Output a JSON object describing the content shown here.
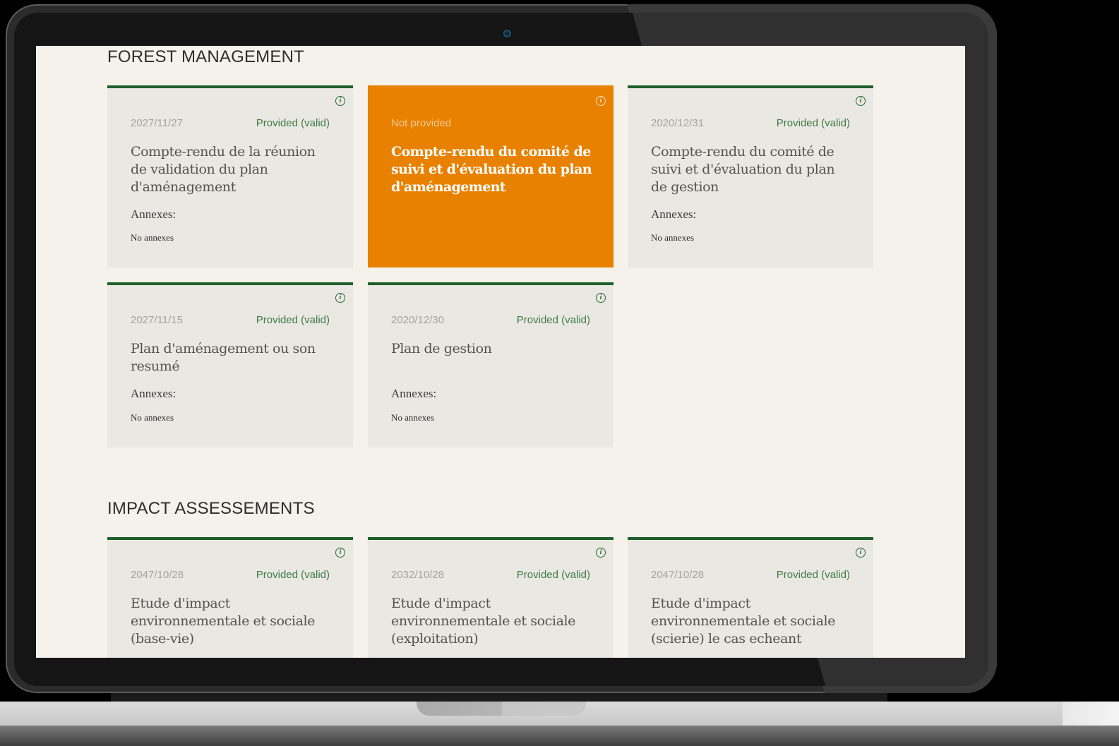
{
  "sections": [
    {
      "title": "FOREST MANAGEMENT",
      "cards": [
        {
          "date": "2027/11/27",
          "status": "Provided (valid)",
          "title": "Compte-rendu de la réunion de validation du plan d'aménagement",
          "annex_label": "Annexes:",
          "annex_value": "No annexes"
        },
        {
          "date": "",
          "status": "Not provided",
          "title": "Compte-rendu du comité de suivi et d'évaluation du plan d'aménagement",
          "annex_label": "",
          "annex_value": "",
          "highlight_color": "#e88100"
        },
        {
          "date": "2020/12/31",
          "status": "Provided (valid)",
          "title": "Compte-rendu du comité de suivi et d'évaluation du plan de gestion",
          "annex_label": "Annexes:",
          "annex_value": "No annexes"
        },
        {
          "date": "2027/11/15",
          "status": "Provided (valid)",
          "title": "Plan d'aménagement ou son resumé",
          "annex_label": "Annexes:",
          "annex_value": "No annexes"
        },
        {
          "date": "2020/12/30",
          "status": "Provided (valid)",
          "title": "Plan de gestion",
          "annex_label": "Annexes:",
          "annex_value": "No annexes"
        }
      ]
    },
    {
      "title": "IMPACT ASSESSEMENTS",
      "cards": [
        {
          "date": "2047/10/28",
          "status": "Provided (valid)",
          "title": "Etude d'impact environnementale et sociale (base-vie)"
        },
        {
          "date": "2032/10/28",
          "status": "Provided (valid)",
          "title": "Etude d'impact environnementale et sociale (exploitation)"
        },
        {
          "date": "2047/10/28",
          "status": "Provided (valid)",
          "title": "Etude d'impact environnementale et sociale (scierie) le cas echeant"
        }
      ]
    }
  ],
  "icons": {
    "info": "info-icon"
  },
  "colors": {
    "accent_green": "#1f5f2e",
    "alert_orange": "#e88100",
    "page_bg": "#f4f2ea"
  }
}
